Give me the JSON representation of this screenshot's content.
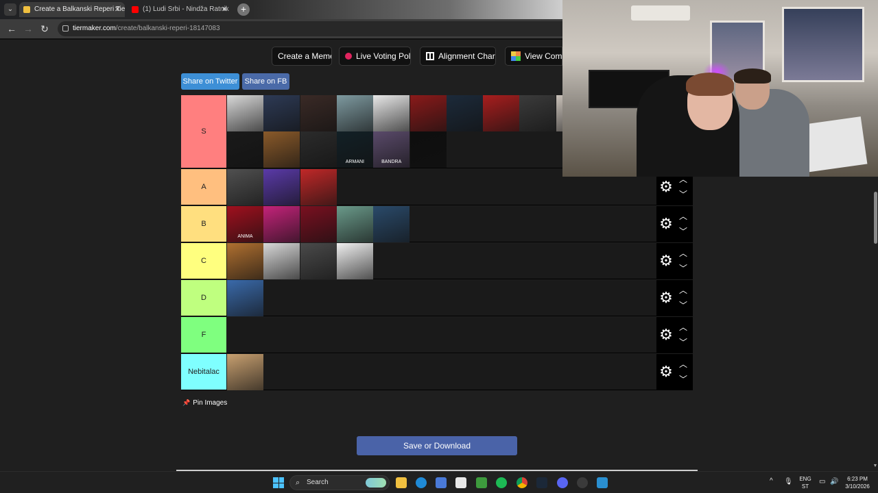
{
  "browser": {
    "tabs": [
      {
        "title": "Create a Balkanski Reperi Tier L",
        "active": true,
        "favicon_color": "#f0c040"
      },
      {
        "title": "(1) Ludi Srbi - Nindža Ratnik",
        "active": false,
        "favicon_color": "#ff0000"
      }
    ],
    "url_host": "tiermaker.com",
    "url_path": "/create/balkanski-reperi-18147083"
  },
  "toolbar": {
    "create_meme": "Create a Meme",
    "live_poll": "Live Voting Poll",
    "alignment_chart": "Alignment Chart",
    "view_comm": "View Comm"
  },
  "share": {
    "twitter": "Share on Twitter",
    "fb": "Share on FB"
  },
  "tiers": [
    {
      "label": "S",
      "color": "#ff7f7f",
      "count": 16,
      "thumbs": [
        "#d9d9d9",
        "#2d3a55",
        "#3a2a26",
        "#7e9aa0",
        "#e8e8e8",
        "#8a1a1a",
        "#1c2a3a",
        "#a81e1e",
        "#3b3b3b",
        "#c8c0b8",
        "#1a1a1a",
        "#8a5a2a",
        "#2b2b2b",
        "#122026",
        "#5a4a6a",
        "#0e0e0e"
      ],
      "captions": {
        "13": "ARMANI",
        "14": "BANDRA"
      }
    },
    {
      "label": "A",
      "color": "#ffbf7f",
      "count": 3,
      "thumbs": [
        "#505050",
        "#5a3aa8",
        "#c02828"
      ]
    },
    {
      "label": "B",
      "color": "#ffdf7f",
      "count": 5,
      "thumbs": [
        "#a0101e",
        "#c4237a",
        "#7a1020",
        "#6a9a8a",
        "#2a4a6a"
      ],
      "captions": {
        "0": "ANIMA"
      }
    },
    {
      "label": "C",
      "color": "#ffff7f",
      "count": 4,
      "thumbs": [
        "#b07030",
        "#d8d8d8",
        "#4a4a4a",
        "#f0f0f0"
      ]
    },
    {
      "label": "D",
      "color": "#bfff7f",
      "count": 1,
      "thumbs": [
        "#3a6aaa"
      ]
    },
    {
      "label": "F",
      "color": "#7fff7f",
      "count": 0,
      "thumbs": []
    },
    {
      "label": "Nebitalac",
      "color": "#7fffff",
      "count": 1,
      "thumbs": [
        "#c8a070"
      ]
    }
  ],
  "pin_label": "Pin Images",
  "save_label": "Save or Download",
  "taskbar": {
    "search_label": "Search",
    "lang": "ENG",
    "lang2": "ST",
    "time": "6:23 PM",
    "date": "3/10/2026"
  }
}
